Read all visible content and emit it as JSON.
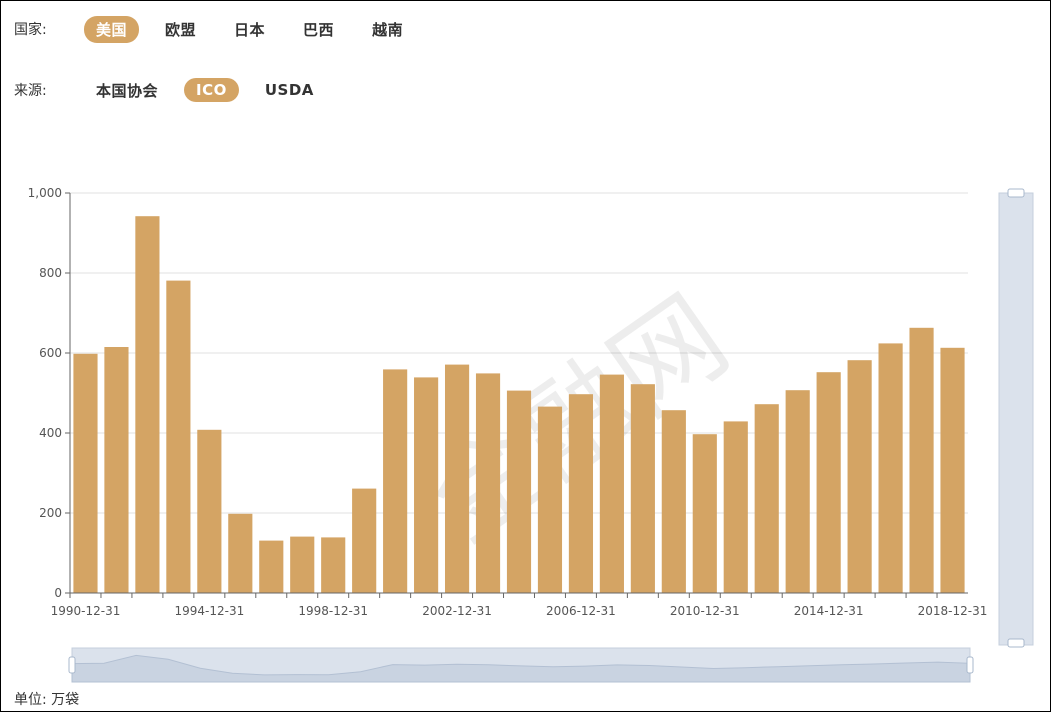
{
  "filters": {
    "country": {
      "label": "国家:",
      "options": [
        "美国",
        "欧盟",
        "日本",
        "巴西",
        "越南"
      ],
      "active_index": 0
    },
    "source": {
      "label": "来源:",
      "options": [
        "本国协会",
        "ICO",
        "USDA"
      ],
      "active_index": 1
    }
  },
  "unit_label": "单位: 万袋",
  "watermark": "金融网",
  "colors": {
    "bar": "#d4a464",
    "accent": "#d4a464",
    "grid": "#e0e0e0",
    "slider_bg": "#dbe2ec",
    "slider_handle": "#a8b8cc"
  },
  "chart_data": {
    "type": "bar",
    "categories": [
      "1990-12-31",
      "1991-12-31",
      "1992-12-31",
      "1993-12-31",
      "1994-12-31",
      "1995-12-31",
      "1996-12-31",
      "1997-12-31",
      "1998-12-31",
      "1999-12-31",
      "2000-12-31",
      "2001-12-31",
      "2002-12-31",
      "2003-12-31",
      "2004-12-31",
      "2005-12-31",
      "2006-12-31",
      "2007-12-31",
      "2008-12-31",
      "2009-12-31",
      "2010-12-31",
      "2011-12-31",
      "2012-12-31",
      "2013-12-31",
      "2014-12-31",
      "2015-12-31",
      "2016-12-31",
      "2017-12-31",
      "2018-12-31"
    ],
    "values": [
      598,
      615,
      942,
      781,
      408,
      198,
      131,
      141,
      139,
      261,
      559,
      539,
      571,
      549,
      506,
      466,
      497,
      546,
      522,
      457,
      397,
      429,
      472,
      507,
      552,
      582,
      624,
      663,
      613
    ],
    "x_tick_labels": [
      "1990-12-31",
      "1994-12-31",
      "1998-12-31",
      "2002-12-31",
      "2006-12-31",
      "2010-12-31",
      "2014-12-31",
      "2018-12-31"
    ],
    "y_tick_labels": [
      "0",
      "200",
      "400",
      "600",
      "800",
      "1,000"
    ],
    "ylim": [
      0,
      1000
    ],
    "grid": true
  }
}
